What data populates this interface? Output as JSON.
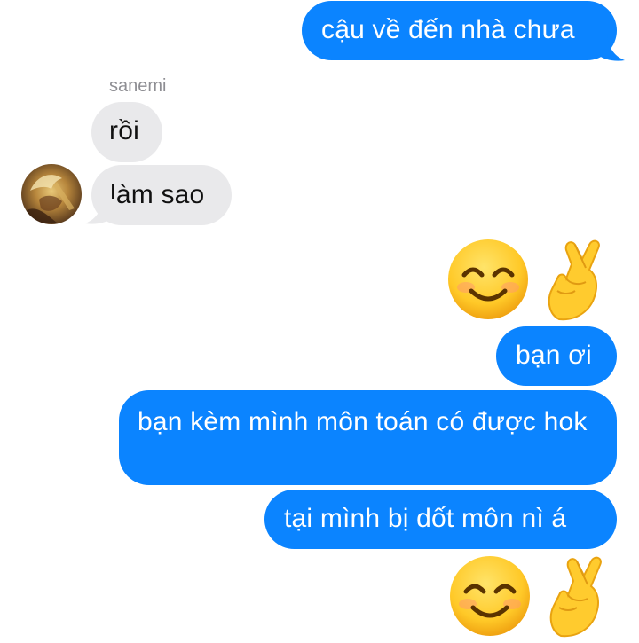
{
  "thread": {
    "sender_name": "sanemi",
    "messages": [
      {
        "direction": "outgoing",
        "text": "cậu về đến nhà chưa"
      },
      {
        "direction": "incoming",
        "text": "rồi"
      },
      {
        "direction": "incoming",
        "text": "làm sao"
      },
      {
        "direction": "outgoing",
        "emoji": [
          "smiling-face-with-smiling-eyes",
          "crossed-fingers"
        ]
      },
      {
        "direction": "outgoing",
        "text": "bạn ơi"
      },
      {
        "direction": "outgoing",
        "text": "bạn kèm mình môn toán có được hok"
      },
      {
        "direction": "outgoing",
        "text": "tại mình bị dốt môn nì á"
      },
      {
        "direction": "outgoing",
        "emoji": [
          "smiling-face-with-smiling-eyes",
          "crossed-fingers"
        ]
      }
    ]
  },
  "colors": {
    "outgoing_bubble": "#0b84ff",
    "incoming_bubble": "#e9e9eb",
    "sender_label": "#8e8e93"
  }
}
